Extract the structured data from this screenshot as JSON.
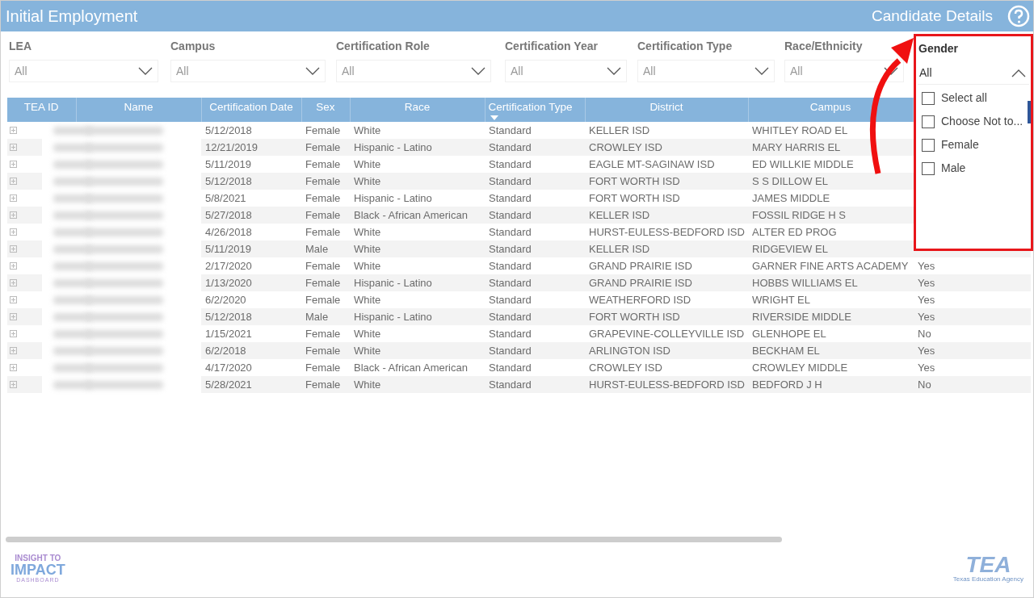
{
  "header": {
    "title": "Initial Employment",
    "section_title": "Candidate Details"
  },
  "filters": [
    {
      "label": "LEA",
      "value": "All"
    },
    {
      "label": "Campus",
      "value": "All"
    },
    {
      "label": "Certification Role",
      "value": "All"
    },
    {
      "label": "Certification Year",
      "value": "All"
    },
    {
      "label": "Certification Type",
      "value": "All"
    },
    {
      "label": "Race/Ethnicity",
      "value": "All"
    }
  ],
  "gender_filter": {
    "label": "Gender",
    "value": "All",
    "expanded": true,
    "options": [
      {
        "label": "Select all",
        "checked": false
      },
      {
        "label": "Choose Not to...",
        "checked": false
      },
      {
        "label": "Female",
        "checked": false
      },
      {
        "label": "Male",
        "checked": false
      }
    ]
  },
  "table": {
    "columns": [
      {
        "label": "TEA ID",
        "sorted": false
      },
      {
        "label": "Name",
        "sorted": false
      },
      {
        "label": "Certification Date",
        "sorted": false
      },
      {
        "label": "Sex",
        "sorted": false
      },
      {
        "label": "Race",
        "sorted": false
      },
      {
        "label": "Certification Type",
        "sorted": true
      },
      {
        "label": "District",
        "sorted": false
      },
      {
        "label": "Campus",
        "sorted": false
      }
    ],
    "rows": [
      {
        "certification_date": "5/12/2018",
        "sex": "Female",
        "race": "White",
        "certification_type": "Standard",
        "district": "KELLER ISD",
        "campus": "WHITLEY ROAD EL"
      },
      {
        "certification_date": "12/21/2019",
        "sex": "Female",
        "race": "Hispanic - Latino",
        "certification_type": "Standard",
        "district": "CROWLEY ISD",
        "campus": "MARY HARRIS EL"
      },
      {
        "certification_date": "5/11/2019",
        "sex": "Female",
        "race": "White",
        "certification_type": "Standard",
        "district": "EAGLE MT-SAGINAW ISD",
        "campus": "ED WILLKIE MIDDLE"
      },
      {
        "certification_date": "5/12/2018",
        "sex": "Female",
        "race": "White",
        "certification_type": "Standard",
        "district": "FORT WORTH ISD",
        "campus": "S S DILLOW EL"
      },
      {
        "certification_date": "5/8/2021",
        "sex": "Female",
        "race": "Hispanic - Latino",
        "certification_type": "Standard",
        "district": "FORT WORTH ISD",
        "campus": "JAMES MIDDLE"
      },
      {
        "certification_date": "5/27/2018",
        "sex": "Female",
        "race": "Black - African American",
        "certification_type": "Standard",
        "district": "KELLER ISD",
        "campus": "FOSSIL RIDGE H S"
      },
      {
        "certification_date": "4/26/2018",
        "sex": "Female",
        "race": "White",
        "certification_type": "Standard",
        "district": "HURST-EULESS-BEDFORD ISD",
        "campus": "ALTER ED PROG"
      },
      {
        "certification_date": "5/11/2019",
        "sex": "Male",
        "race": "White",
        "certification_type": "Standard",
        "district": "KELLER ISD",
        "campus": "RIDGEVIEW EL"
      },
      {
        "certification_date": "2/17/2020",
        "sex": "Female",
        "race": "White",
        "certification_type": "Standard",
        "district": "GRAND PRAIRIE ISD",
        "campus": "GARNER FINE ARTS ACADEMY",
        "column_9": "Yes"
      },
      {
        "certification_date": "1/13/2020",
        "sex": "Female",
        "race": "Hispanic - Latino",
        "certification_type": "Standard",
        "district": "GRAND PRAIRIE ISD",
        "campus": "HOBBS WILLIAMS EL",
        "column_9": "Yes"
      },
      {
        "certification_date": "6/2/2020",
        "sex": "Female",
        "race": "White",
        "certification_type": "Standard",
        "district": "WEATHERFORD ISD",
        "campus": "WRIGHT EL",
        "column_9": "Yes"
      },
      {
        "certification_date": "5/12/2018",
        "sex": "Male",
        "race": "Hispanic - Latino",
        "certification_type": "Standard",
        "district": "FORT WORTH ISD",
        "campus": "RIVERSIDE MIDDLE",
        "column_9": "Yes"
      },
      {
        "certification_date": "1/15/2021",
        "sex": "Female",
        "race": "White",
        "certification_type": "Standard",
        "district": "GRAPEVINE-COLLEYVILLE ISD",
        "campus": "GLENHOPE EL",
        "column_9": "No"
      },
      {
        "certification_date": "6/2/2018",
        "sex": "Female",
        "race": "White",
        "certification_type": "Standard",
        "district": "ARLINGTON ISD",
        "campus": "BECKHAM EL",
        "column_9": "Yes"
      },
      {
        "certification_date": "4/17/2020",
        "sex": "Female",
        "race": "Black - African American",
        "certification_type": "Standard",
        "district": "CROWLEY ISD",
        "campus": "CROWLEY MIDDLE",
        "column_9": "Yes"
      },
      {
        "certification_date": "5/28/2021",
        "sex": "Female",
        "race": "White",
        "certification_type": "Standard",
        "district": "HURST-EULESS-BEDFORD ISD",
        "campus": "BEDFORD J H",
        "column_9": "No"
      }
    ]
  },
  "footer": {
    "left_logo": {
      "lines": [
        "INSIGHT TO",
        "IMPACT",
        "DASHBOARD"
      ]
    },
    "right_logo": {
      "name": "TEA",
      "subtitle": "Texas Education Agency"
    }
  }
}
